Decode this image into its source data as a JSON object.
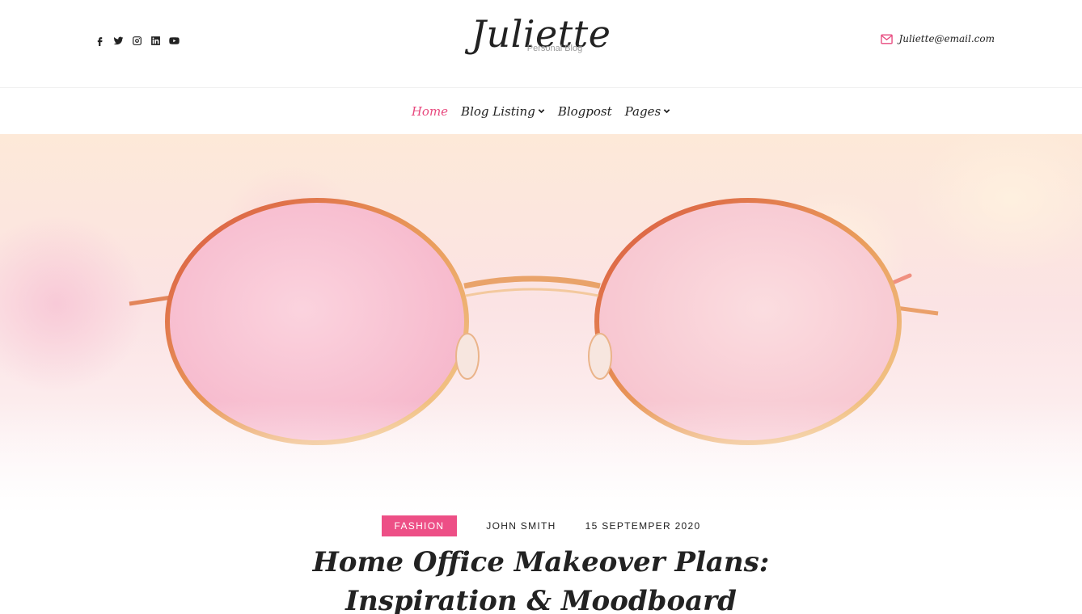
{
  "header": {
    "social": [
      "facebook-icon",
      "twitter-icon",
      "instagram-icon",
      "linkedin-icon",
      "youtube-icon"
    ],
    "brand_title": "Juliette",
    "brand_subtitle": "Personal Blog",
    "email": "Juliette@email.com"
  },
  "nav": {
    "items": [
      {
        "label": "Home",
        "active": true,
        "dropdown": false
      },
      {
        "label": "Blog Listing",
        "active": false,
        "dropdown": true
      },
      {
        "label": "Blogpost",
        "active": false,
        "dropdown": false
      },
      {
        "label": "Pages",
        "active": false,
        "dropdown": true
      }
    ]
  },
  "post": {
    "category": "FASHION",
    "author": "JOHN SMITH",
    "date": "15 SEPTEMPER 2020",
    "title": "Home Office Makeover Plans: Inspiration & Moodboard"
  },
  "colors": {
    "accent": "#ed4f86",
    "text": "#222222",
    "muted": "#9a9a9a"
  }
}
